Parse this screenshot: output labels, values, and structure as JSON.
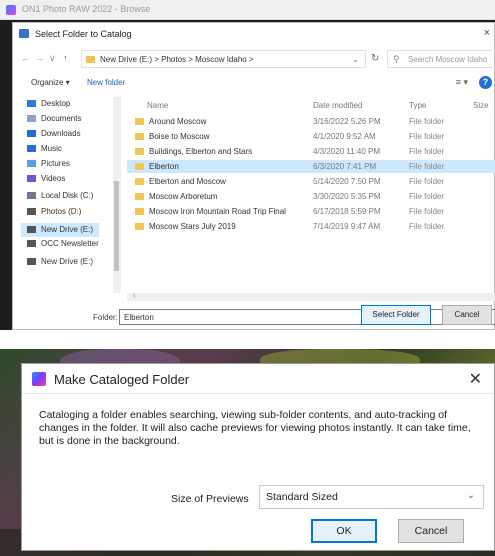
{
  "folder_picker": {
    "app_title": "ON1 Photo RAW 2022 - Browse",
    "dialog_title": "Select Folder to Catalog",
    "close_glyph": "×",
    "nav_buttons": [
      "←",
      "→",
      "∨",
      "↑"
    ],
    "address": {
      "crumbs": "New Drive (E:)  >  Photos  >  Moscow Idaho  >"
    },
    "search_placeholder": "Search Moscow Idaho",
    "toolbar": {
      "organize": "Organize ▾",
      "new_folder": "New folder"
    },
    "nav_items": [
      {
        "label": "Desktop",
        "color": "#2f7ad9"
      },
      {
        "label": "Documents",
        "color": "#8aa2c7"
      },
      {
        "label": "Downloads",
        "color": "#1f6fd0"
      },
      {
        "label": "Music",
        "color": "#2b6ccf"
      },
      {
        "label": "Pictures",
        "color": "#5aa0e0"
      },
      {
        "label": "Videos",
        "color": "#6a5acd"
      },
      {
        "label": "Local Disk (C:)",
        "color": "#6c7a89"
      },
      {
        "label": "Photos (D:)",
        "color": "#555555"
      },
      {
        "label": "New Drive (E:)",
        "color": "#555555"
      },
      {
        "label": "OCC Newsletter",
        "color": "#555555"
      },
      {
        "label": "New Drive (E:)",
        "color": "#555555"
      }
    ],
    "columns": {
      "name": "Name",
      "date": "Date modified",
      "type": "Type",
      "size": "Size"
    },
    "files": [
      {
        "name": "Around Moscow",
        "date": "3/16/2022 5:26 PM",
        "type": "File folder"
      },
      {
        "name": "Boise to Moscow",
        "date": "4/1/2020 9:52 AM",
        "type": "File folder"
      },
      {
        "name": "Buildings, Elberton and Stars",
        "date": "4/3/2020 11:40 PM",
        "type": "File folder"
      },
      {
        "name": "Elberton",
        "date": "6/3/2020 7:41 PM",
        "type": "File folder"
      },
      {
        "name": "Elberton and Moscow",
        "date": "5/14/2020 7:50 PM",
        "type": "File folder"
      },
      {
        "name": "Moscow Arboretum",
        "date": "3/30/2020 5:35 PM",
        "type": "File folder"
      },
      {
        "name": "Moscow Iron Mountain Road Trip  Final",
        "date": "6/17/2018 5:59 PM",
        "type": "File folder"
      },
      {
        "name": "Moscow Stars July 2019",
        "date": "7/14/2019 9:47 AM",
        "type": "File folder"
      }
    ],
    "selected_file_index": 3,
    "folder_label": "Folder:",
    "folder_value": "Elberton",
    "select_button": "Select Folder",
    "cancel_button": "Cancel"
  },
  "catalog_dialog": {
    "title": "Make Cataloged Folder",
    "close_glyph": "✕",
    "description": "Cataloging a folder enables searching, viewing sub-folder contents, and auto-tracking of changes in the folder. It will also cache previews for viewing photos instantly. It can take time, but is done in the background.",
    "size_label": "Size of Previews",
    "size_value": "Standard Sized",
    "ok_button": "OK",
    "cancel_button": "Cancel"
  }
}
